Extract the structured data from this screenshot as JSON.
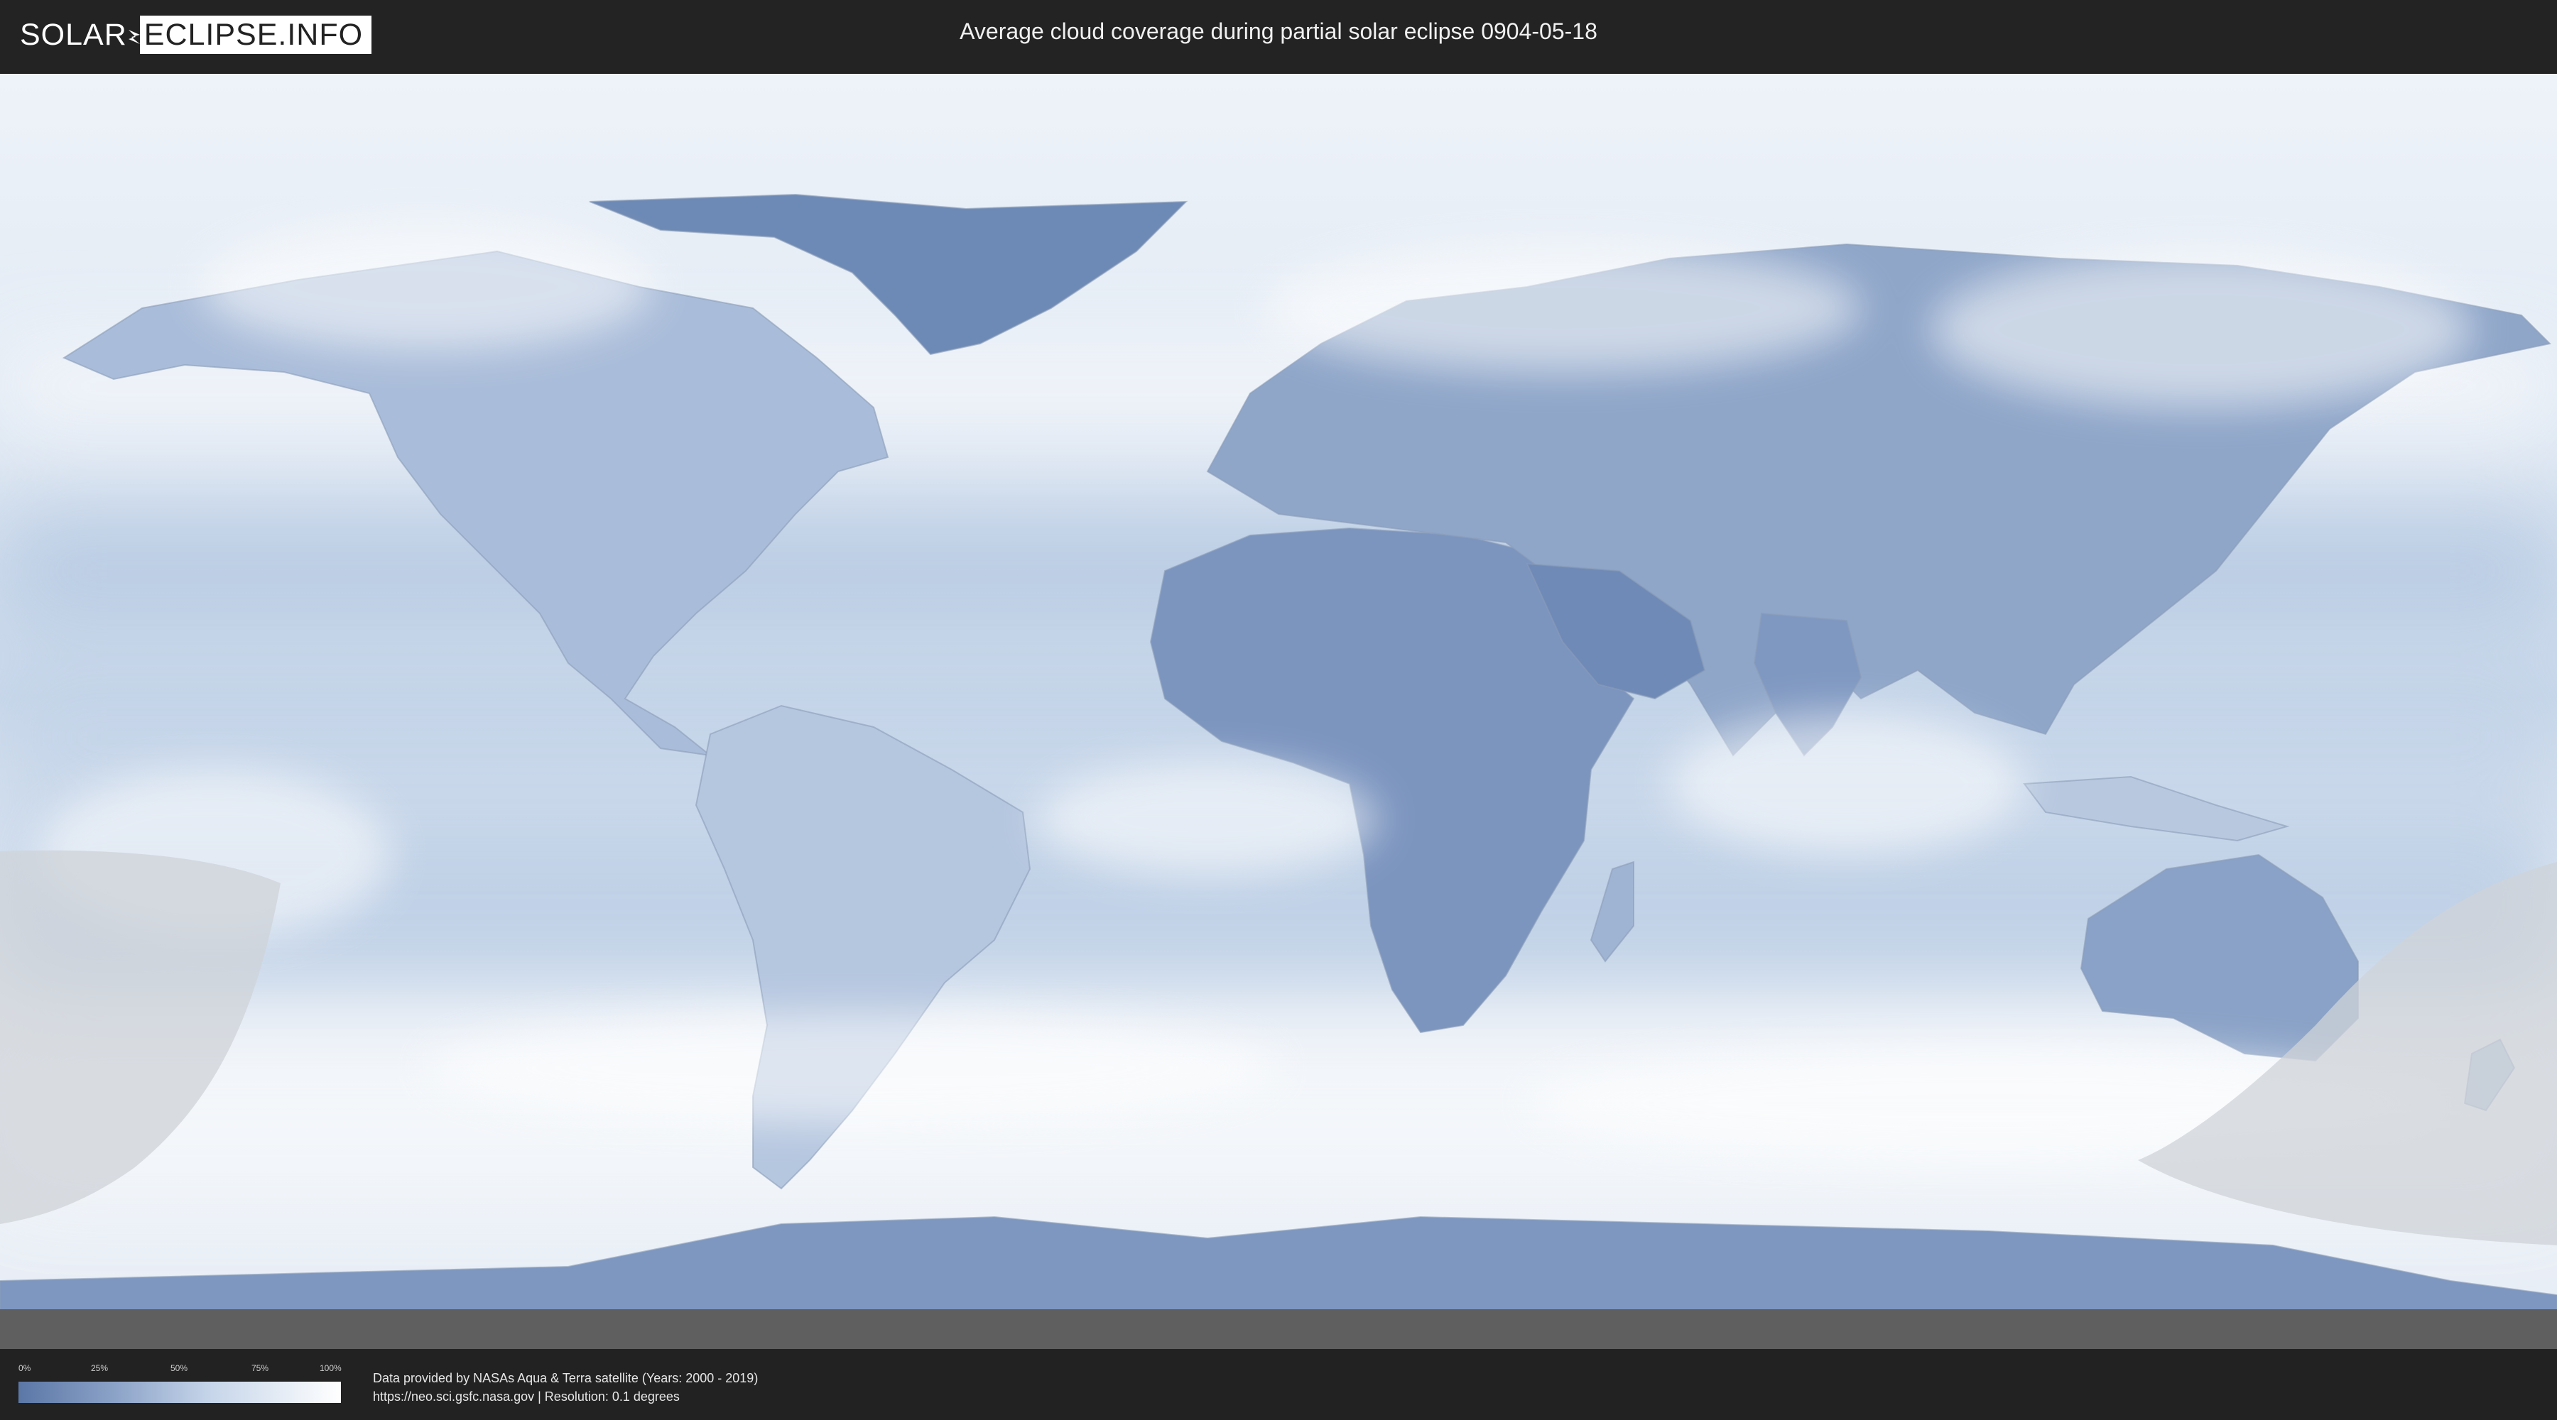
{
  "header": {
    "logo_part1": "SOLAR",
    "logo_part2": "ECLIPSE.INFO",
    "title": "Average cloud coverage during partial solar eclipse 0904-05-18"
  },
  "legend": {
    "ticks": [
      "0%",
      "25%",
      "50%",
      "75%",
      "100%"
    ],
    "color_low": "#5b77a6",
    "color_high": "#ffffff"
  },
  "footer": {
    "credit_line1": "Data provided by NASAs Aqua & Terra satellite (Years: 2000 - 2019)",
    "credit_line2": "https://neo.sci.gsfc.nasa.gov | Resolution: 0.1 degrees"
  },
  "map": {
    "ocean_color": "#dfe8f3",
    "land_color": "#7f98c0",
    "cloud_color": "#f4f7fb",
    "eclipse_shadow_color": "#cfd3d8"
  }
}
